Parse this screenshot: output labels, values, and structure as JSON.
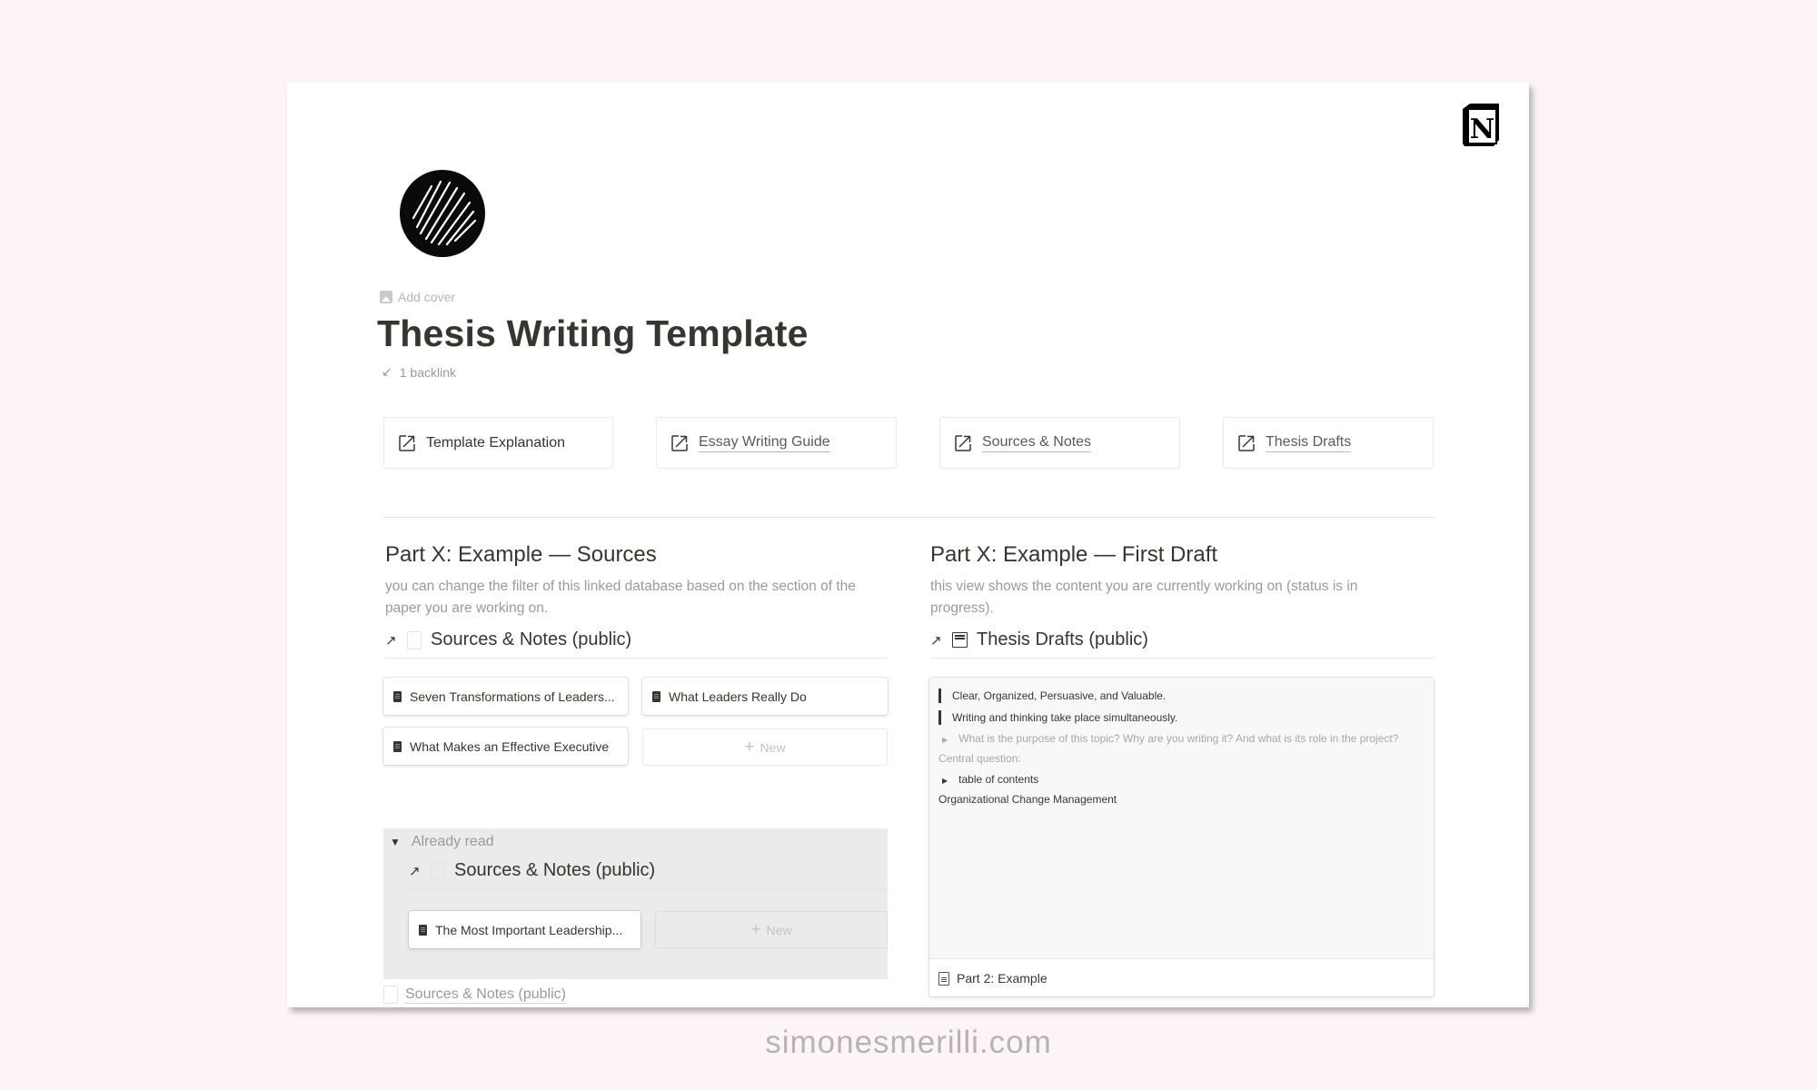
{
  "page": {
    "title": "Thesis Writing Template",
    "add_cover_label": "Add cover",
    "backlinks_label": "1 backlink",
    "page_icon": "scribbled-circle-icon",
    "brand_icon": "notion-logo-icon"
  },
  "link_cards": [
    {
      "label": "Template Explanation",
      "icon": "external-link-icon",
      "underlined": false
    },
    {
      "label": "Essay Writing Guide",
      "icon": "external-link-icon",
      "underlined": true
    },
    {
      "label": "Sources & Notes",
      "icon": "external-link-icon",
      "underlined": true
    },
    {
      "label": "Thesis Drafts",
      "icon": "external-link-icon",
      "underlined": true
    }
  ],
  "left_column": {
    "heading": "Part X: Example — Sources",
    "description": "you can change the filter of this linked database based on the section of the paper you are working on.",
    "database_title": "Sources & Notes (public)",
    "gallery_cards": [
      "Seven Transformations of Leaders...",
      "What Leaders Really Do",
      "What Makes an Effective Executive"
    ],
    "new_label": "New",
    "toggle": {
      "label": "Already read",
      "database_title": "Sources & Notes (public)",
      "gallery_cards": [
        "The Most Important Leadership..."
      ],
      "new_label": "New"
    },
    "bottom_link": "Sources & Notes (public)"
  },
  "right_column": {
    "heading": "Part X: Example — First Draft",
    "description": "this view shows the content you are currently working on (status is in progress).",
    "database_title": "Thesis Drafts (public)",
    "preview_lines": [
      {
        "text": "Clear, Organized, Persuasive, and Valuable.",
        "type": "quote"
      },
      {
        "text": "Writing and thinking take place simultaneously.",
        "type": "quote"
      },
      {
        "text": "What is the purpose of this topic? Why are you writing it? And what is its role in the project?",
        "type": "toggle-muted"
      },
      {
        "text": "Central question:",
        "type": "muted"
      },
      {
        "text": "table of contents",
        "type": "toggle"
      },
      {
        "text": "Organizational Change Management",
        "type": "text"
      }
    ],
    "card_title": "Part 2: Example"
  },
  "watermark": "simonesmerilli.com",
  "colors": {
    "background": "#fdf5f5",
    "text": "#37352f",
    "muted": "#9b9a97",
    "toggle_block_bg": "#ebebec"
  }
}
